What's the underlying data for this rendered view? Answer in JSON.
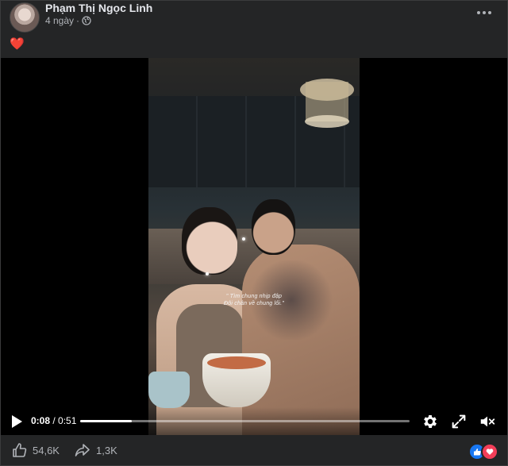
{
  "post": {
    "author": "Phạm Thị Ngọc Linh",
    "time": "4 ngày",
    "caption": "❤️"
  },
  "video": {
    "subtitle_line1": "\" Tìm chung nhịp đập",
    "subtitle_line2": "Đôi chân về chung lối.\"",
    "current_time": "0:08",
    "total_time": " / 0:51",
    "progress": 0.157
  },
  "footer": {
    "likes": "54,6K",
    "shares": "1,3K"
  },
  "colors": {
    "accent": "#1877f2",
    "love": "#f33e58",
    "heart": "#f02849"
  }
}
